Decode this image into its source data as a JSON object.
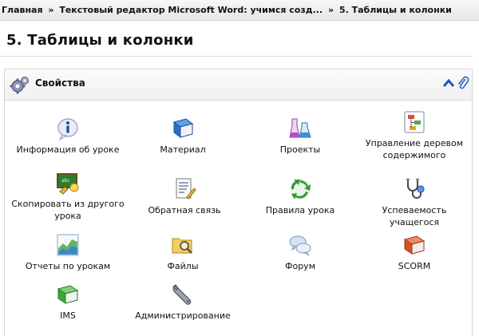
{
  "breadcrumb": {
    "home": "Главная",
    "course": "Текстовый редактор Microsoft Word: учимся созд...",
    "current": "5. Таблицы и колонки",
    "separator": "»"
  },
  "page_title": "5. Таблицы и колонки",
  "panel": {
    "title": "Свойства",
    "icons": {
      "header": "gears-icon",
      "collapse": "collapse-up-icon",
      "attach": "paperclip-icon"
    }
  },
  "items": [
    {
      "label": "Информация об уроке",
      "icon": "info-icon"
    },
    {
      "label": "Материал",
      "icon": "book-icon"
    },
    {
      "label": "Проекты",
      "icon": "flasks-icon"
    },
    {
      "label": "Управление деревом содержимого",
      "icon": "content-tree-icon"
    },
    {
      "label": "Скопировать из другого урока",
      "icon": "copy-lesson-icon"
    },
    {
      "label": "Обратная связь",
      "icon": "feedback-form-icon"
    },
    {
      "label": "Правила урока",
      "icon": "recycle-rules-icon"
    },
    {
      "label": "Успеваемость учащегося",
      "icon": "stethoscope-icon"
    },
    {
      "label": "Отчеты по урокам",
      "icon": "report-chart-icon"
    },
    {
      "label": "Файлы",
      "icon": "folder-search-icon"
    },
    {
      "label": "Форум",
      "icon": "forum-bubbles-icon"
    },
    {
      "label": "SCORM",
      "icon": "scorm-book-icon"
    },
    {
      "label": "IMS",
      "icon": "ims-book-icon"
    },
    {
      "label": "Администрирование",
      "icon": "wrench-icon"
    }
  ]
}
